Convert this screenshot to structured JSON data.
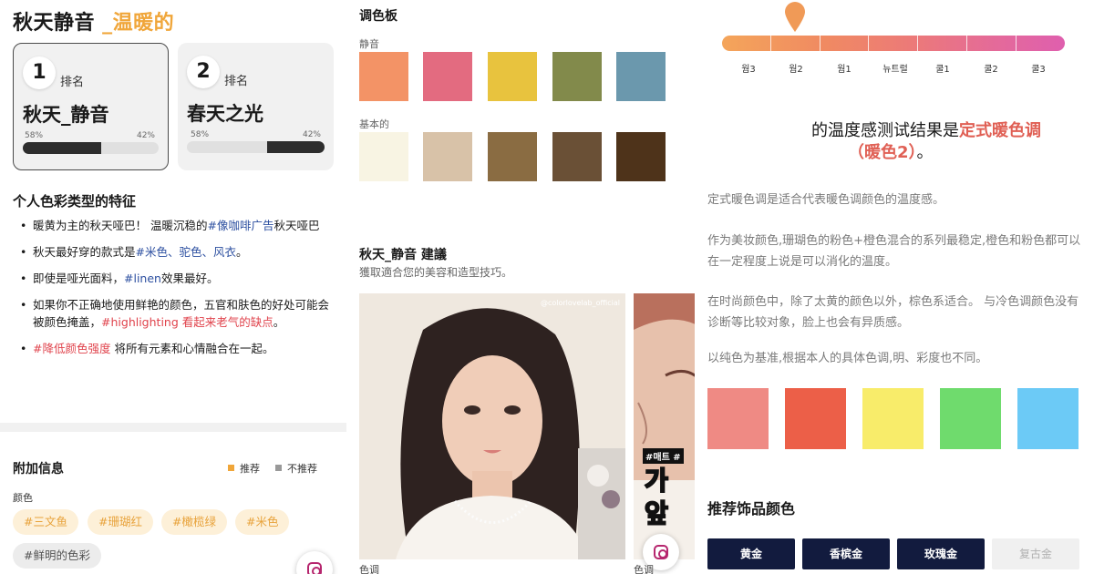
{
  "left": {
    "title_main": "秋天静音 ",
    "title_accent": "_温暖的",
    "cards": [
      {
        "rank": "1",
        "rank_label": "排名",
        "name": "秋天_静音",
        "pct_left": "58%",
        "pct_right": "42%",
        "fill_fraction": 0.58
      },
      {
        "rank": "2",
        "rank_label": "排名",
        "name": "春天之光",
        "pct_left": "58%",
        "pct_right": "42%",
        "fill_fraction": 0.42
      }
    ],
    "features_title": "个人色彩类型的特征",
    "bullets": [
      {
        "a": "暖黄为主的秋天哑巴！ 温暖沉稳的",
        "b": "#像咖啡广告",
        "c": "秋天哑巴"
      },
      {
        "a": "秋天最好穿的款式是",
        "b": "#米色、驼色、风衣",
        "c": "。"
      },
      {
        "a": "即使是哑光面料，",
        "b": "#linen",
        "c": "效果最好。"
      },
      {
        "a": "如果你不正确地使用鲜艳的颜色，五官和肤色的好处可能会被颜色掩盖，",
        "b": "#highlighting 看起来老气的缺点",
        "c": "。"
      },
      {
        "a": "",
        "b": "#降低颜色强度",
        "c": " 将所有元素和心情融合在一起。"
      }
    ],
    "extra_title": "附加信息",
    "legend_rec": "推荐",
    "legend_norec": "不推荐",
    "color_label": "颜色",
    "tags": [
      "#三文鱼",
      "#珊瑚红",
      "#橄榄绿",
      "#米色",
      "#鲜明的色彩"
    ]
  },
  "middle": {
    "palette_title": "调色板",
    "mute_label": "静音",
    "base_label": "基本的",
    "mute_colors": [
      "#f39366",
      "#e36b80",
      "#e8c33e",
      "#828a4b",
      "#6b98ad"
    ],
    "base_colors": [
      "#f8f4e3",
      "#d8c2a8",
      "#8a6c42",
      "#6a5036",
      "#4e331a"
    ],
    "rec_title": "秋天_静音 建議",
    "rec_sub": "獲取適合您的美容和造型技巧。",
    "photo_watermark": "@colorlovelab_official",
    "photo2_badge": "#매트 #",
    "photo2_text": "가\n앞",
    "caption1": "色调",
    "caption2": "色调"
  },
  "right": {
    "scale_labels": [
      "웜3",
      "웜2",
      "웜1",
      "뉴트럴",
      "쿨1",
      "쿨2",
      "쿨3"
    ],
    "marker_position": 1,
    "result_prefix": "的温度感测试结果是",
    "result_highlight": "定式暖色调",
    "result_paren": "（暖色2）",
    "result_end": "。",
    "para1": "定式暖色调是适合代表暖色调颜色的温度感。",
    "para2": "作为美妆颜色,珊瑚色的粉色+橙色混合的系列最稳定,橙色和粉色都可以在一定程度上说是可以消化的温度。",
    "para3": "在时尚颜色中，除了太黄的颜色以外，棕色系适合。 与冷色调颜色没有诊断等比较对象，脸上也会有异质感。",
    "para4": "以纯色为基准,根据本人的具体色调,明、彩度也不同。",
    "temp_colors": [
      "#ef8a84",
      "#ec5f48",
      "#f8ec6a",
      "#6fdb6d",
      "#6ccaf6"
    ],
    "acc_title": "推荐饰品颜色",
    "acc_buttons": [
      "黄金",
      "香槟金",
      "玫瑰金",
      "复古金"
    ]
  },
  "colors": {
    "accent_orange": "#f0a63a",
    "link_blue": "#2c4fa0",
    "link_red": "#e0434c",
    "result_coral": "#e06055",
    "navy": "#121b3e"
  }
}
